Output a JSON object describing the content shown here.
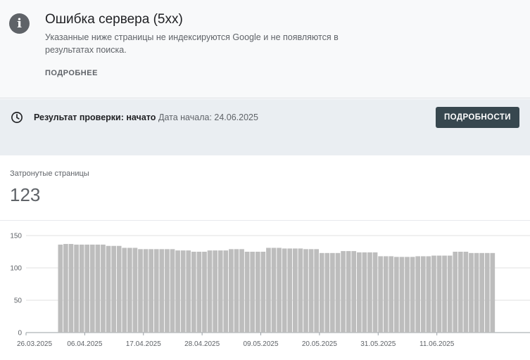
{
  "issue": {
    "title": "Ошибка сервера (5xx)",
    "description": "Указанные ниже страницы не индексируются Google и не появляются в результатах поиска.",
    "more_label": "ПОДРОБНЕЕ",
    "icon": "info-icon"
  },
  "validation": {
    "icon": "clock-icon",
    "label": "Результат проверки: начато",
    "date": "Дата начала: 24.06.2025",
    "button_label": "ПОДРОБНОСТИ"
  },
  "affected": {
    "label": "Затронутые страницы",
    "value": "123"
  },
  "colors": {
    "bar": "#bdbdbd",
    "button": "#37474f",
    "icon": "#5f6368"
  },
  "chart_data": {
    "type": "bar",
    "yticks": [
      0,
      50,
      100,
      150
    ],
    "ylim": [
      0,
      150
    ],
    "xtick_labels": [
      "26.03.2025",
      "06.04.2025",
      "17.04.2025",
      "28.04.2025",
      "09.05.2025",
      "20.05.2025",
      "31.05.2025",
      "11.06.2025"
    ],
    "xtick_days": [
      0,
      11,
      22,
      33,
      44,
      55,
      66,
      77
    ],
    "first_bar_day": 6,
    "values": [
      136,
      137,
      137,
      136,
      136,
      136,
      136,
      136,
      136,
      134,
      134,
      134,
      131,
      131,
      131,
      129,
      129,
      129,
      129,
      129,
      129,
      129,
      127,
      127,
      127,
      125,
      125,
      125,
      127,
      127,
      127,
      127,
      129,
      129,
      129,
      125,
      125,
      125,
      125,
      131,
      131,
      131,
      130,
      130,
      130,
      130,
      129,
      129,
      129,
      123,
      123,
      123,
      123,
      126,
      126,
      126,
      124,
      124,
      124,
      124,
      118,
      118,
      118,
      117,
      117,
      117,
      117,
      118,
      118,
      118,
      119,
      119,
      119,
      119,
      125,
      125,
      125,
      123,
      123,
      123,
      123,
      123
    ]
  }
}
